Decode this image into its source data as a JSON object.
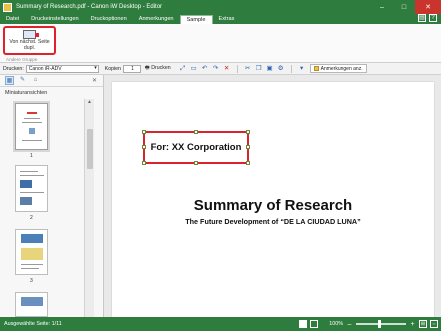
{
  "window": {
    "title": "Summary of Research.pdf - Canon iW Desktop - Editor"
  },
  "menu": {
    "items": [
      {
        "label": "Datei"
      },
      {
        "label": "Druckeinstellungen"
      },
      {
        "label": "Druckoptionen"
      },
      {
        "label": "Anmerkungen"
      },
      {
        "label": "Sample"
      },
      {
        "label": "Extras"
      }
    ],
    "active_index": 4
  },
  "ribbon": {
    "button_label": "Von nächst. Seite dupl.",
    "group_label": "Andere Gruppe"
  },
  "toolbar": {
    "printer_label": "Drucken:",
    "printer_value": "Canon iR-ADV",
    "copies_label": "Kopien",
    "copies_value": "1",
    "print_button": "Drucken",
    "annotations_label": "Anmerkungen anz."
  },
  "sidepanel": {
    "title": "Miniaturansichten",
    "thumbnails": [
      {
        "number": "1"
      },
      {
        "number": "2"
      },
      {
        "number": "3"
      }
    ]
  },
  "document": {
    "annotation_text": "For: XX Corporation",
    "title": "Summary of Research",
    "subtitle": "The Future Development of “DE LA CIUDAD LUNA”"
  },
  "status": {
    "left_text": "Ausgewählte Seite: 1/11",
    "zoom": "100%"
  },
  "colors": {
    "brand_green": "#2f7d3e",
    "highlight_red": "#d9242d"
  }
}
